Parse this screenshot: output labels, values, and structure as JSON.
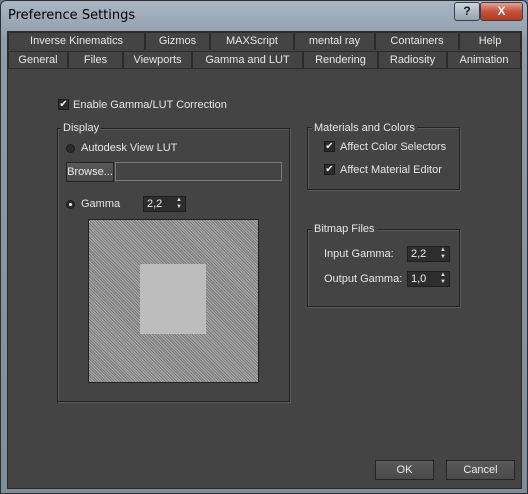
{
  "window": {
    "title": "Preference Settings",
    "help_label": "?",
    "close_label": "X"
  },
  "tabs_row1": [
    "Inverse Kinematics",
    "Gizmos",
    "MAXScript",
    "mental ray",
    "Containers",
    "Help"
  ],
  "tabs_row2": [
    "General",
    "Files",
    "Viewports",
    "Gamma and LUT",
    "Rendering",
    "Radiosity",
    "Animation"
  ],
  "active_tab": "Gamma and LUT",
  "enable_gamma": {
    "label": "Enable Gamma/LUT Correction",
    "checked": true
  },
  "display": {
    "title": "Display",
    "lut_radio": {
      "label": "Autodesk View LUT",
      "selected": false
    },
    "browse_label": "Browse...",
    "path_value": "",
    "gamma_radio": {
      "label": "Gamma",
      "selected": true
    },
    "gamma_value": "2,2"
  },
  "materials_colors": {
    "title": "Materials and Colors",
    "affect_color_selectors": {
      "label": "Affect Color Selectors",
      "checked": true
    },
    "affect_material_editor": {
      "label": "Affect Material Editor",
      "checked": true
    }
  },
  "bitmap_files": {
    "title": "Bitmap Files",
    "input_gamma_label": "Input Gamma:",
    "input_gamma_value": "2,2",
    "output_gamma_label": "Output Gamma:",
    "output_gamma_value": "1,0"
  },
  "footer": {
    "ok_label": "OK",
    "cancel_label": "Cancel"
  },
  "colors": {
    "panel_bg": "#444444",
    "titlebar": "#9aa9b5",
    "close_red": "#c7503b"
  }
}
